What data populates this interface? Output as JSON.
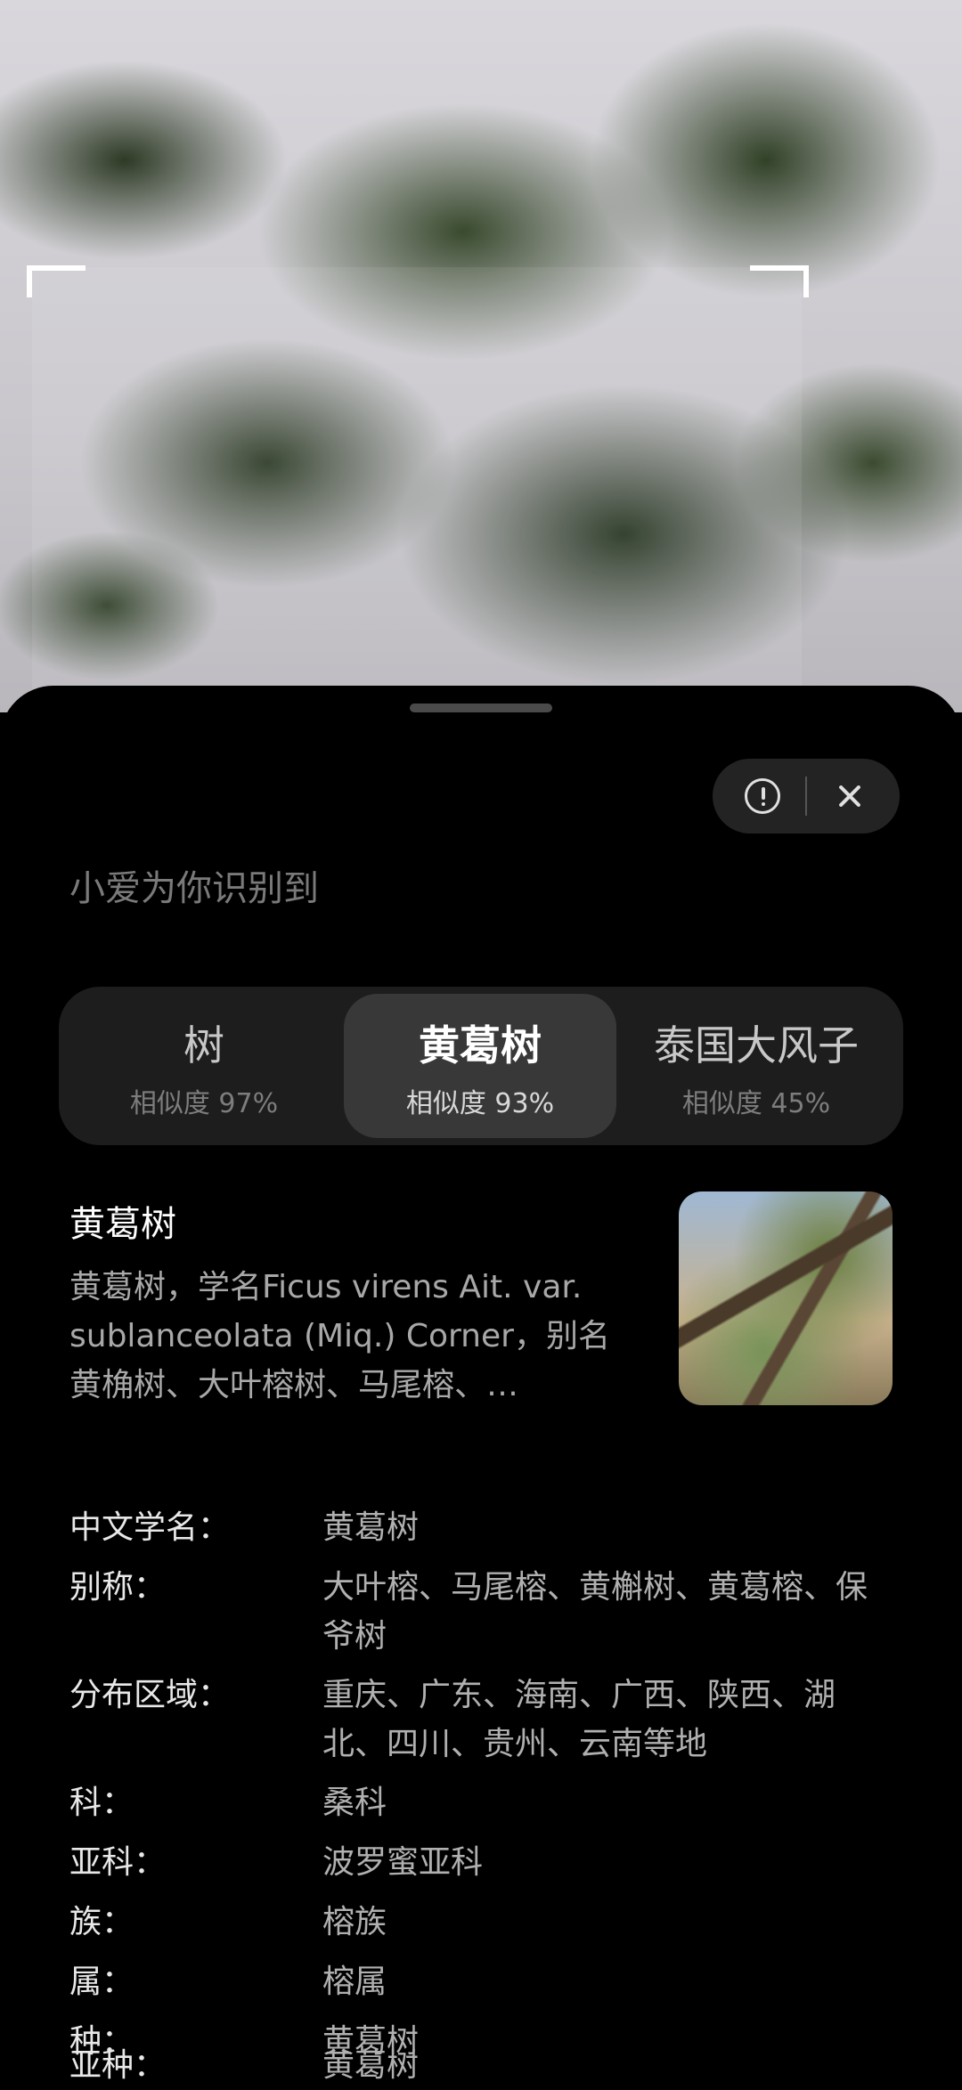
{
  "header": {
    "report_icon": "info-report-icon",
    "close_icon": "close-icon"
  },
  "subtitle": "小爱为你识别到",
  "results": [
    {
      "name": "树",
      "similarity": "相似度 97%"
    },
    {
      "name": "黄葛树",
      "similarity": "相似度 93%"
    },
    {
      "name": "泰国大风子",
      "similarity": "相似度 45%"
    }
  ],
  "selected_index": 1,
  "summary": {
    "title": "黄葛树",
    "description": "黄葛树，学名Ficus virens Ait. var. sublanceolata (Miq.) Corner，别名黄桷树、大叶榕树、马尾榕、…"
  },
  "details": [
    {
      "label": "中文学名：",
      "value": "黄葛树"
    },
    {
      "label": "别称：",
      "value": "大叶榕、马尾榕、黄槲树、黄葛榕、保爷树"
    },
    {
      "label": "分布区域：",
      "value": "重庆、广东、海南、广西、陕西、湖北、四川、贵州、云南等地"
    },
    {
      "label": "科：",
      "value": "桑科"
    },
    {
      "label": "亚科：",
      "value": "波罗蜜亚科"
    },
    {
      "label": "族：",
      "value": "榕族"
    },
    {
      "label": "属：",
      "value": "榕属"
    },
    {
      "label": "种：",
      "value": "黄葛树"
    },
    {
      "label": "亚种：",
      "value": "黄葛树"
    }
  ]
}
